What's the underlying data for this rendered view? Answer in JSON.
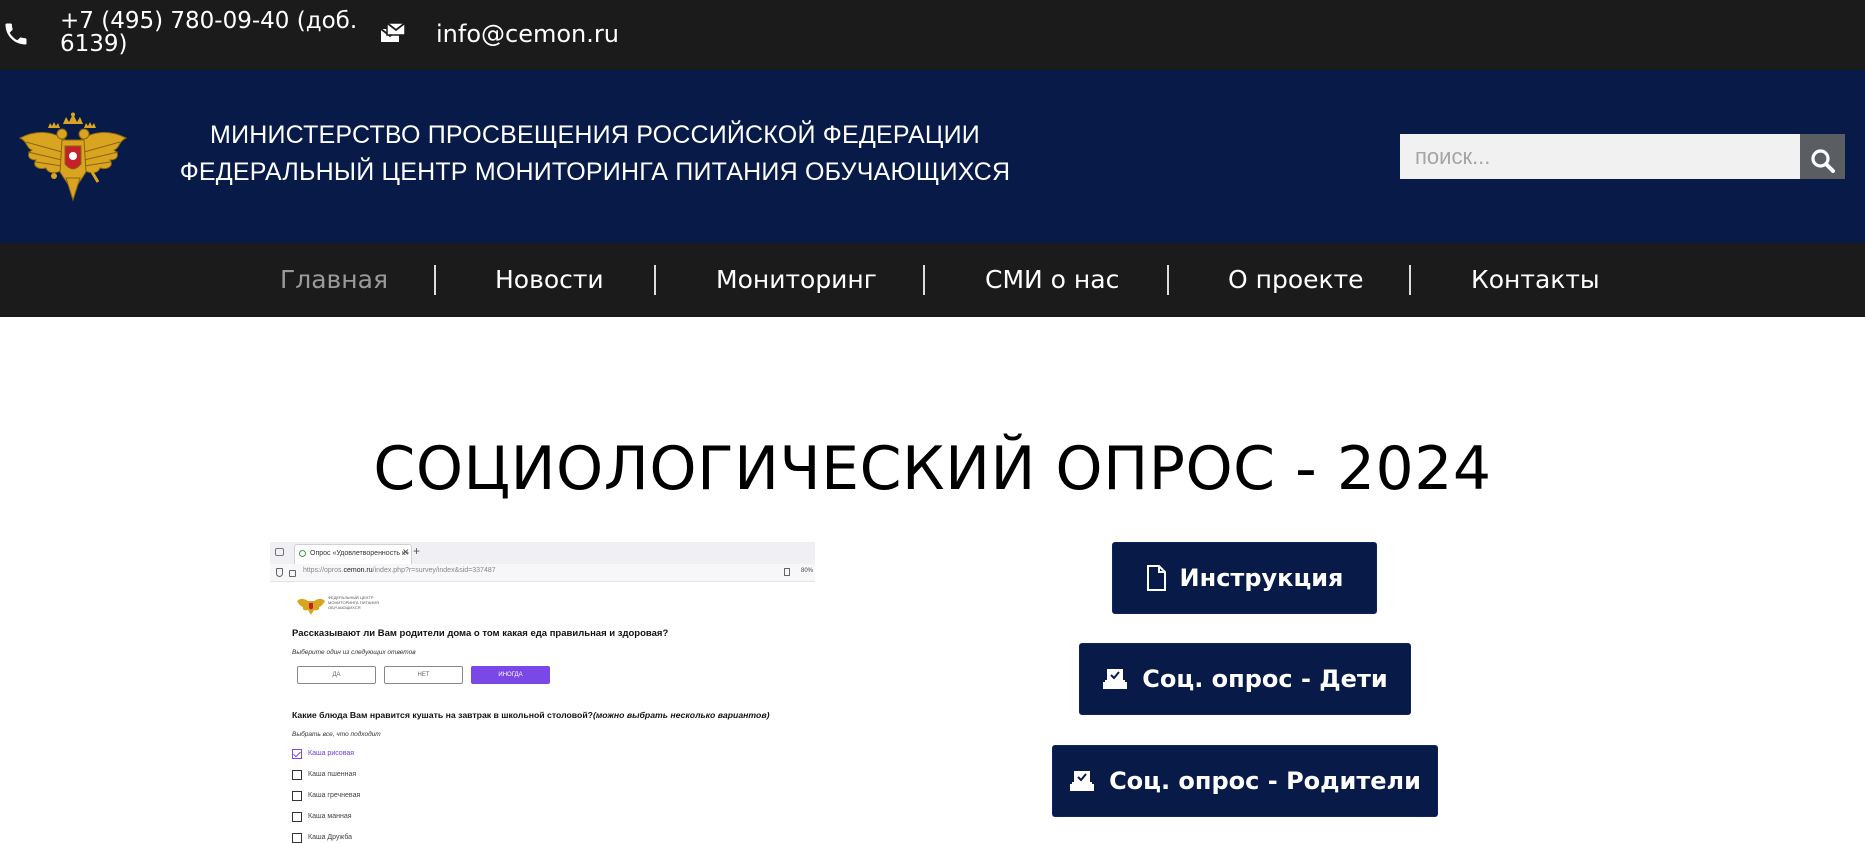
{
  "topbar": {
    "phone": "+7 (495) 780-09-40 (доб. 6139)",
    "email": "info@cemon.ru",
    "phone_icon": "phone-icon",
    "email_icon": "mail-stack-icon"
  },
  "header": {
    "emblem": "russian-coat-of-arms-emblem",
    "title_line1": "МИНИСТЕРСТВО ПРОСВЕЩЕНИЯ РОССИЙСКОЙ ФЕДЕРАЦИИ",
    "title_line2": "ФЕДЕРАЛЬНЫЙ ЦЕНТР МОНИТОРИНГА ПИТАНИЯ ОБУЧАЮЩИХСЯ",
    "search_placeholder": "поиск...",
    "search_icon": "search-icon"
  },
  "nav": {
    "items": [
      {
        "label": "Главная",
        "active": true
      },
      {
        "label": "Новости",
        "active": false
      },
      {
        "label": "Мониторинг",
        "active": false
      },
      {
        "label": "СМИ о нас",
        "active": false
      },
      {
        "label": "О проекте",
        "active": false
      },
      {
        "label": "Контакты",
        "active": false
      }
    ]
  },
  "main": {
    "heading": "СОЦИОЛОГИЧЕСКИЙ ОПРОС - 2024",
    "buttons": {
      "instruction": {
        "label": "Инструкция",
        "icon": "document-icon"
      },
      "survey_kids": {
        "label": "Соц. опрос - Дети",
        "icon": "vote-box-icon"
      },
      "survey_parents": {
        "label": "Соц. опрос - Родители",
        "icon": "vote-box-icon"
      }
    }
  },
  "screenshot": {
    "tab_title": "Опрос «Удовлетворенность к»",
    "url_prefix": "https://opros.",
    "url_domain": "cemon.ru",
    "url_suffix": "/index.php?r=survey/index&sid=337487",
    "zoom": "80%",
    "org_name": "ФЕДЕРАЛЬНЫЙ ЦЕНТР МОНИТОРИНГА ПИТАНИЯ ОБУЧАЮЩИХСЯ",
    "question1": "Рассказывают ли Вам родители дома о том какая еда правильная и здоровая?",
    "question1_hint": "Выберите один из следующих ответов",
    "answers": [
      "ДА",
      "НЕТ",
      "ИНОГДА"
    ],
    "answer_selected": "ИНОГДА",
    "question2": "Какие блюда Вам нравится кушать на завтрак в школьной столовой?",
    "question2_note": "(можно выбрать несколько вариантов)",
    "question2_hint": "Выбрать все, что подходит",
    "options": [
      {
        "label": "Каша рисовая",
        "checked": true
      },
      {
        "label": "Каша пшенная",
        "checked": false
      },
      {
        "label": "Каша гречневая",
        "checked": false
      },
      {
        "label": "Каша манная",
        "checked": false
      },
      {
        "label": "Каша Дружба",
        "checked": false
      }
    ]
  },
  "colors": {
    "topbar_bg": "#1b1b1b",
    "header_bg": "#071a48",
    "button_bg": "#071a48",
    "nav_active": "#9a9a9a",
    "accent_purple": "#7b48e8"
  }
}
